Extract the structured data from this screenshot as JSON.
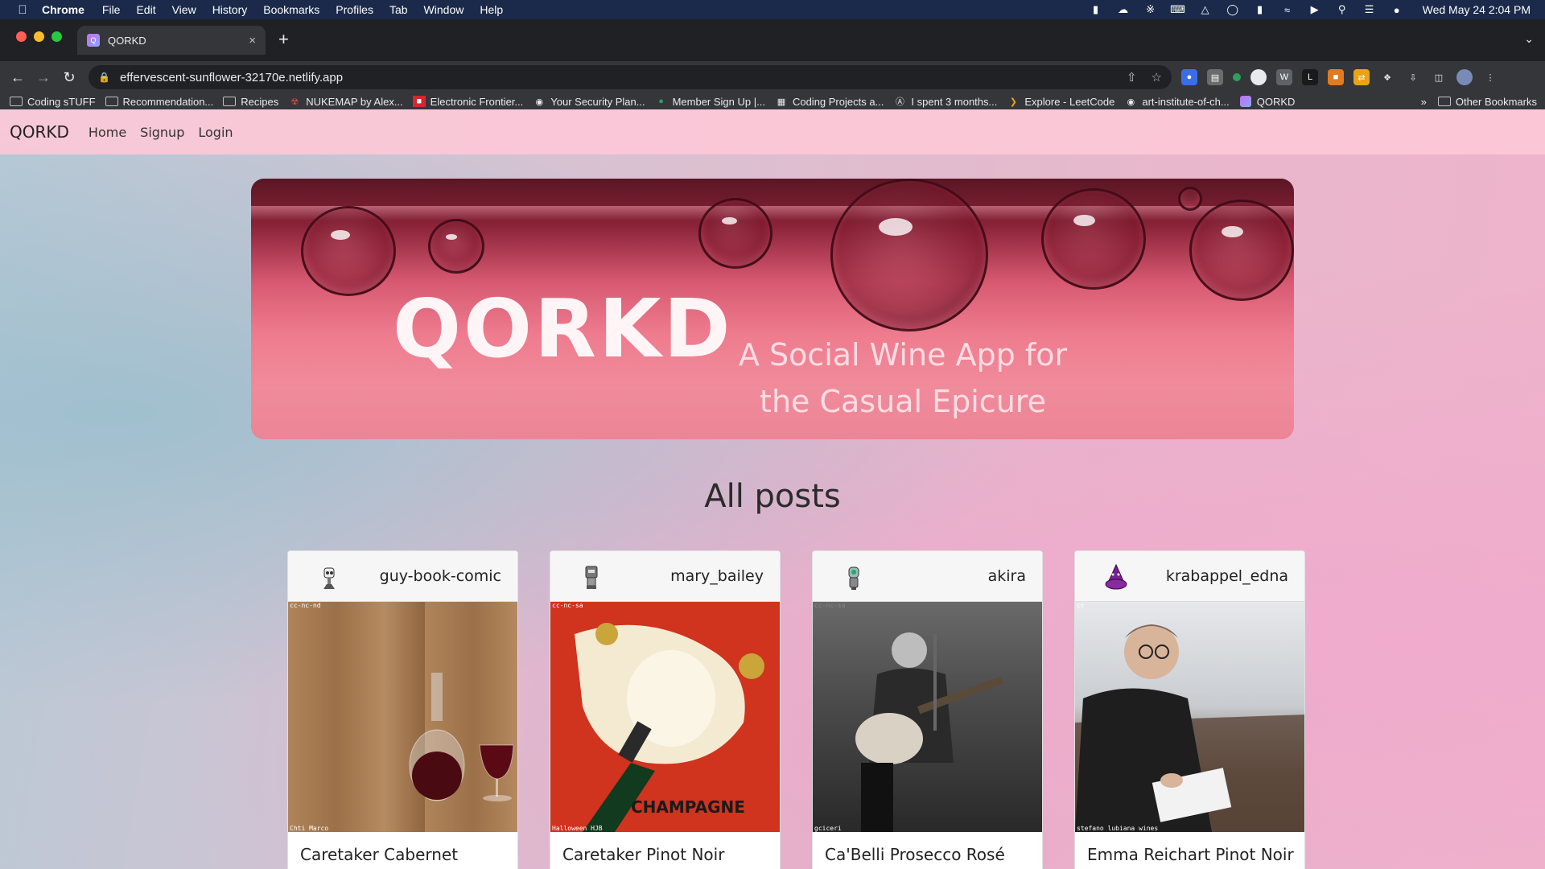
{
  "menubar": {
    "app": "Chrome",
    "items": [
      "File",
      "Edit",
      "View",
      "History",
      "Bookmarks",
      "Profiles",
      "Tab",
      "Window",
      "Help"
    ],
    "clock": "Wed May 24  2:04 PM"
  },
  "tab": {
    "title": "QORKD",
    "close": "×",
    "new": "+",
    "list_menu": "⌄"
  },
  "toolbar": {
    "back": "←",
    "forward": "→",
    "reload": "↻",
    "url": "effervescent-sunflower-32170e.netlify.app"
  },
  "bookmarks": {
    "items": [
      "Coding sTUFF",
      "Recommendation...",
      "Recipes",
      "NUKEMAP by Alex...",
      "Electronic Frontier...",
      "Your Security Plan...",
      "Member Sign Up |...",
      "Coding Projects a...",
      "I spent 3 months...",
      "Explore - LeetCode",
      "art-institute-of-ch...",
      "QORKD"
    ],
    "more": "»",
    "other": "Other Bookmarks"
  },
  "site": {
    "brand": "QORKD",
    "nav": [
      "Home",
      "Signup",
      "Login"
    ],
    "hero_title": "QORKD",
    "hero_subtitle": "A Social Wine App for the Casual Epicure",
    "heading": "All posts"
  },
  "posts": [
    {
      "user": "guy-book-comic",
      "title": "Caretaker Cabernet",
      "license": "cc-nc-nd",
      "credit": "Chti Marco"
    },
    {
      "user": "mary_bailey",
      "title": "Caretaker Pinot Noir",
      "license": "cc-nc-sa",
      "credit": "Halloween HJB",
      "poster_text": "CHAMPAGNE"
    },
    {
      "user": "akira",
      "title": "Ca'Belli Prosecco Rosé",
      "license": "cc-nc-sa",
      "credit": "gciceri"
    },
    {
      "user": "krabappel_edna",
      "title": "Emma Reichart Pinot Noir",
      "license": "cc",
      "credit": "stefano lubiana wines"
    }
  ]
}
